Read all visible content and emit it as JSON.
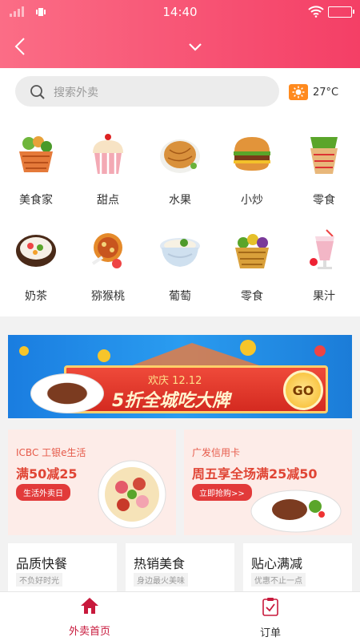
{
  "status_bar": {
    "time": "14:40"
  },
  "search": {
    "placeholder": "搜索外卖"
  },
  "weather": {
    "temperature": "27°C"
  },
  "categories_row1": [
    "美食家",
    "甜点",
    "水果",
    "小炒",
    "零食"
  ],
  "categories_row2": [
    "奶茶",
    "猕猴桃",
    "葡萄",
    "零食",
    "果汁"
  ],
  "banner": {
    "subtitle": "欢庆 12.12",
    "title": "5折全城吃大牌",
    "go_label": "GO"
  },
  "promo_left": {
    "bank": "ICBC 工银e生活",
    "offer": "满50减25",
    "tag": "生活外卖日"
  },
  "promo_right": {
    "bank": "广发信用卡",
    "offer": "周五享全场满25减50",
    "tag": "立即抢购>>"
  },
  "cards": [
    {
      "title": "品质快餐",
      "subtitle": "不负好时光"
    },
    {
      "title": "热销美食",
      "subtitle": "身边最火美味"
    },
    {
      "title": "贴心满减",
      "subtitle": "优惠不止一点"
    }
  ],
  "tabs": [
    {
      "label": "外卖首页",
      "active": true
    },
    {
      "label": "订单",
      "active": false
    }
  ],
  "colors": {
    "accent": "#f43f66",
    "tab_active": "#c8193c"
  }
}
